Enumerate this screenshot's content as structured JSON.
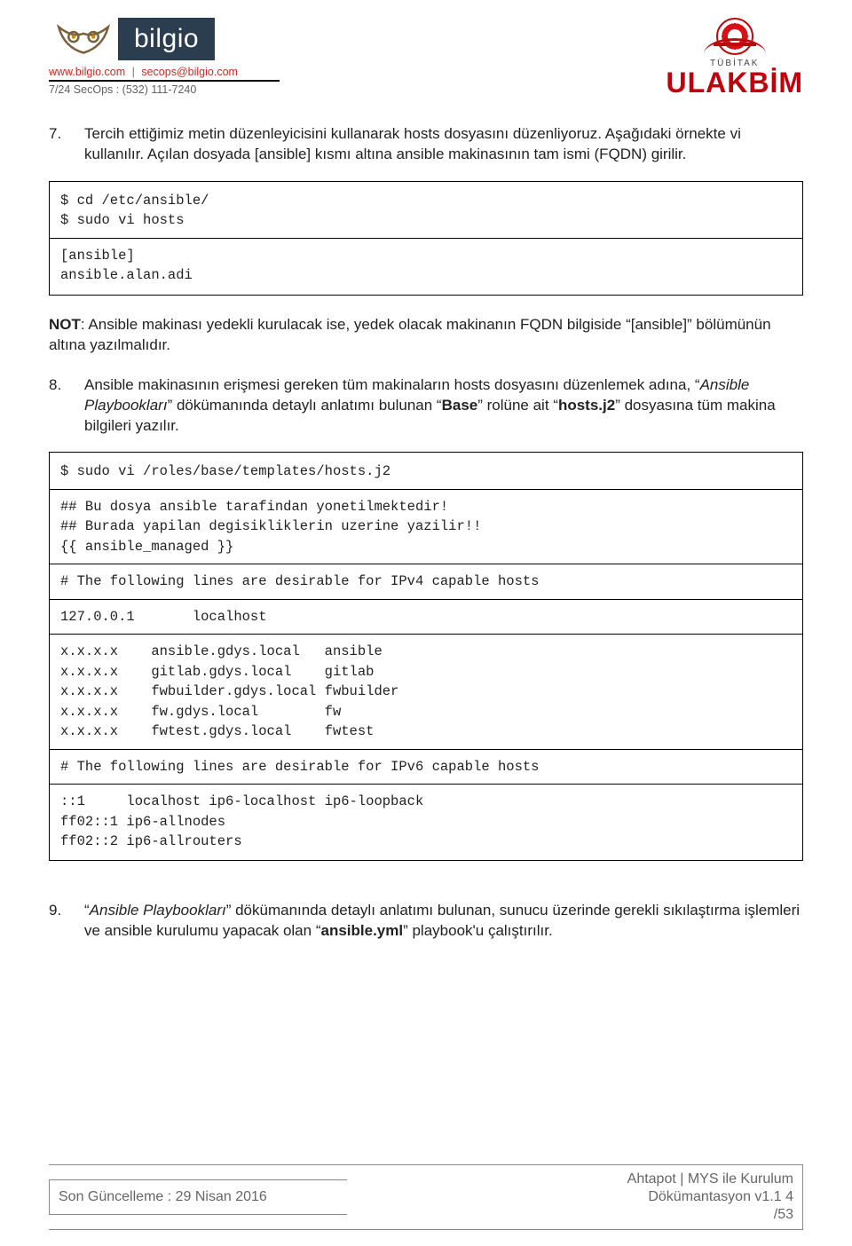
{
  "header": {
    "brand": "bilgio",
    "contact_site": "www.bilgio.com",
    "contact_email": "secops@bilgio.com",
    "secops_line": "7/24 SecOps : (532) 111-7240",
    "tubitak": "TÜBİTAK",
    "ulakbim": "ULAKBİM"
  },
  "items": {
    "n7": "7.",
    "p7": "Tercih ettiğimiz metin düzenleyicisini kullanarak hosts dosyasını düzenliyoruz. Aşağıdaki örnekte vi kullanılır. Açılan dosyada [ansible] kısmı altına ansible makinasının tam ismi (FQDN) girilir.",
    "code7a": "$ cd /etc/ansible/\n$ sudo vi hosts",
    "code7b": "[ansible]\nansible.alan.adi",
    "note7_label": "NOT",
    "note7_body": ": Ansible makinası yedekli kurulacak ise, yedek olacak makinanın FQDN bilgiside “[ansible]” bölümünün altına yazılmalıdır.",
    "n8": "8.",
    "p8_a": "Ansible makinasının erişmesi gereken tüm makinaların hosts dosyasını düzenlemek adına, “",
    "p8_i": "Ansible Playbookları",
    "p8_b": "” dökümanında detaylı anlatımı bulunan “",
    "p8_bold1": "Base",
    "p8_c": "” rolüne ait “",
    "p8_bold2": "hosts.j2",
    "p8_d": "” dosyasına tüm makina bilgileri yazılır.",
    "code8a": "$ sudo vi /roles/base/templates/hosts.j2",
    "code8b": "## Bu dosya ansible tarafindan yonetilmektedir!\n## Burada yapilan degisikliklerin uzerine yazilir!!\n{{ ansible_managed }}",
    "code8c": "# The following lines are desirable for IPv4 capable hosts",
    "code8d": "127.0.0.1       localhost",
    "code8e": "x.x.x.x    ansible.gdys.local   ansible\nx.x.x.x    gitlab.gdys.local    gitlab\nx.x.x.x    fwbuilder.gdys.local fwbuilder\nx.x.x.x    fw.gdys.local        fw\nx.x.x.x    fwtest.gdys.local    fwtest",
    "code8f": "# The following lines are desirable for IPv6 capable hosts",
    "code8g": "::1     localhost ip6-localhost ip6-loopback\nff02::1 ip6-allnodes\nff02::2 ip6-allrouters",
    "n9": "9.",
    "p9_a": "“",
    "p9_i": "Ansible Playbookları",
    "p9_b": "” dökümanında detaylı anlatımı bulunan, sunucu üzerinde gerekli sıkılaştırma işlemleri ve ansible kurulumu yapacak olan “",
    "p9_bold": "ansible.yml",
    "p9_c": "” playbook'u çalıştırılır."
  },
  "footer": {
    "left": "Son Güncelleme : 29 Nisan 2016",
    "right1": "Ahtapot | MYS ile Kurulum",
    "right2": "Dökümantasyon v1.1 4",
    "right3": "/53"
  }
}
